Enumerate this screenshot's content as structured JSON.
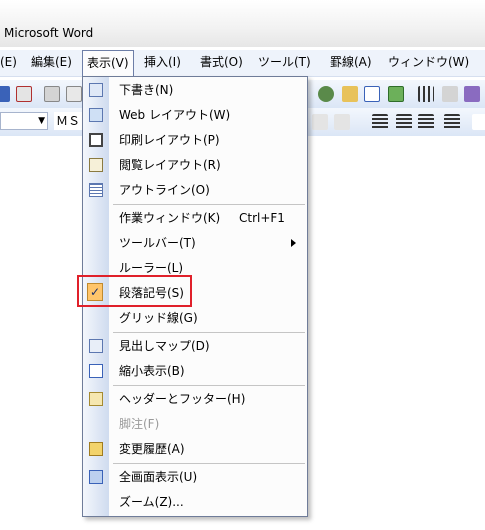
{
  "window": {
    "title": "Microsoft Word"
  },
  "menubar": {
    "items": [
      {
        "label": "(E)"
      },
      {
        "label": "編集(E)"
      },
      {
        "label": "表示(V)"
      },
      {
        "label": "挿入(I)"
      },
      {
        "label": "書式(O)"
      },
      {
        "label": "ツール(T)"
      },
      {
        "label": "罫線(A)"
      },
      {
        "label": "ウィンドウ(W)"
      }
    ]
  },
  "toolbar": {
    "font_name": "ＭＳ"
  },
  "view_menu": {
    "items": [
      {
        "label": "下書き(N)",
        "icon": "draft-view-icon"
      },
      {
        "label": "Web レイアウト(W)",
        "icon": "web-layout-icon"
      },
      {
        "label": "印刷レイアウト(P)",
        "icon": "print-layout-icon"
      },
      {
        "label": "閲覧レイアウト(R)",
        "icon": "reading-layout-icon"
      },
      {
        "label": "アウトライン(O)",
        "icon": "outline-icon"
      },
      {
        "label": "作業ウィンドウ(K)",
        "shortcut": "Ctrl+F1"
      },
      {
        "label": "ツールバー(T)",
        "submenu": true
      },
      {
        "label": "ルーラー(L)"
      },
      {
        "label": "段落記号(S)",
        "checked": true,
        "check_glyph": "✓"
      },
      {
        "label": "グリッド線(G)"
      },
      {
        "label": "見出しマップ(D)",
        "icon": "document-map-icon"
      },
      {
        "label": "縮小表示(B)",
        "icon": "thumbnails-icon"
      },
      {
        "label": "ヘッダーとフッター(H)",
        "icon": "header-footer-icon"
      },
      {
        "label": "脚注(F)",
        "disabled": true
      },
      {
        "label": "変更履歴(A)",
        "icon": "track-changes-icon"
      },
      {
        "label": "全画面表示(U)",
        "icon": "full-screen-icon"
      },
      {
        "label": "ズーム(Z)..."
      }
    ]
  },
  "colors": {
    "highlight_border": "#e0202a",
    "check_background": "#ffc56b"
  }
}
